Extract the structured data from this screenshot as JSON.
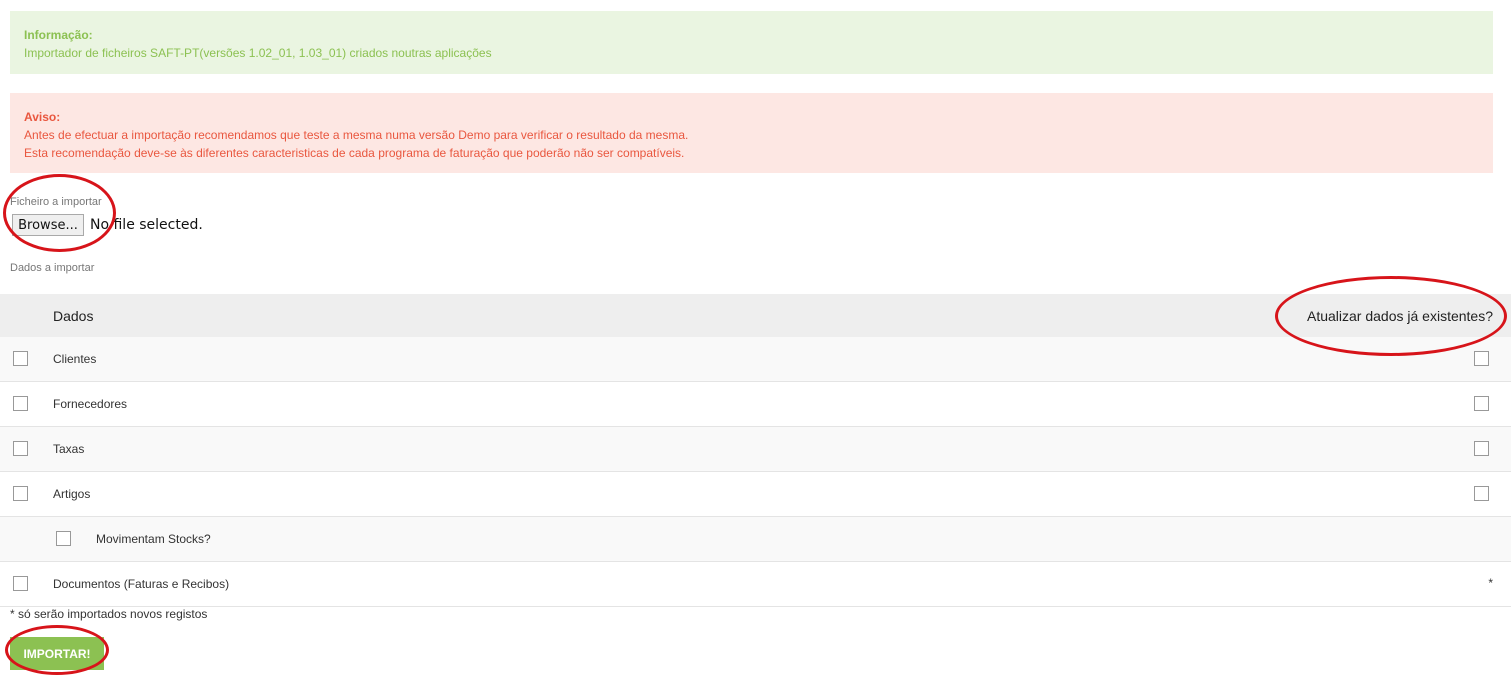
{
  "info": {
    "title": "Informação:",
    "text": "Importador de ficheiros SAFT-PT(versões 1.02_01, 1.03_01) criados noutras aplicações"
  },
  "warning": {
    "title": "Aviso:",
    "line1": "Antes de efectuar a importação recomendamos que teste a mesma numa versão Demo para verificar o resultado da mesma.",
    "line2": "Esta recomendação deve-se às diferentes caracteristicas de cada programa de faturação que poderão não ser compatíveis."
  },
  "file": {
    "label": "Ficheiro a importar",
    "browse_label": "Browse...",
    "status": "No file selected."
  },
  "data_label": "Dados a importar",
  "table": {
    "col_data": "Dados",
    "col_update": "Atualizar dados já existentes?",
    "rows": [
      {
        "label": "Clientes",
        "checked": false,
        "update_checked": false
      },
      {
        "label": "Fornecedores",
        "checked": false,
        "update_checked": false
      },
      {
        "label": "Taxas",
        "checked": false,
        "update_checked": false
      },
      {
        "label": "Artigos",
        "checked": false,
        "update_checked": false
      },
      {
        "label": "Movimentam Stocks?",
        "checked": false
      },
      {
        "label": "Documentos (Faturas e Recibos)",
        "checked": false,
        "update_note": "*"
      }
    ]
  },
  "footnote": "* só serão importados novos registos",
  "import_label": "IMPORTAR!",
  "colors": {
    "info_bg": "#eaf5e1",
    "info_text": "#8cc152",
    "warn_bg": "#fde7e3",
    "warn_text": "#e9573f",
    "button_green": "#8cc152",
    "annotation_red": "#d7141a"
  }
}
